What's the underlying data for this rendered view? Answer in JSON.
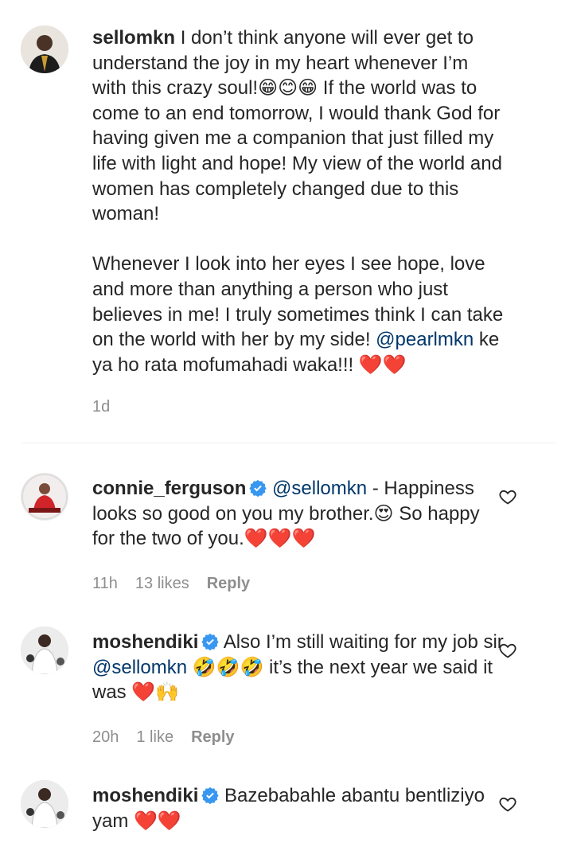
{
  "comments": [
    {
      "username": "sellomkn",
      "paragraph1": "I don’t think anyone will ever get to understand the joy in my heart whenever I’m with this crazy soul!😁😊😁 If the world was to come to an end tomorrow, I would thank God for having given me a companion that just filled my life with light and hope! My view of the world and women has completely changed due to this woman!",
      "paragraph2_before": "Whenever I look into her eyes I see hope, love and more than anything a person who just believes in me! I truly sometimes think I can take on the world with her by my side! ",
      "mention": "@pearlmkn",
      "paragraph2_after": " ke ya ho rata mofumahadi waka!!! ❤️❤️",
      "time": "1d"
    },
    {
      "username": "connie_ferguson",
      "verified": true,
      "mention": "@sellomkn",
      "text": " - Happiness looks so good on you my brother.😍 So happy for the two of you.❤️❤️❤️",
      "time": "11h",
      "likes": "13 likes",
      "reply": "Reply"
    },
    {
      "username": "moshendiki",
      "verified": true,
      "text_before": "Also I’m still waiting for my job sir ",
      "mention": "@sellomkn",
      "text_after": " 🤣🤣🤣 it’s the next year we said it was ❤️🙌",
      "time": "20h",
      "likes": "1 like",
      "reply": "Reply"
    },
    {
      "username": "moshendiki",
      "verified": true,
      "text": "Bazebabahle abantu bentliziyo yam ❤️❤️"
    }
  ],
  "colors": {
    "mention": "#00376b",
    "verified": "#3897f0",
    "meta": "#8e8e8e"
  },
  "icons": {
    "like": "heart-outline-icon",
    "verified": "verified-badge-icon"
  }
}
